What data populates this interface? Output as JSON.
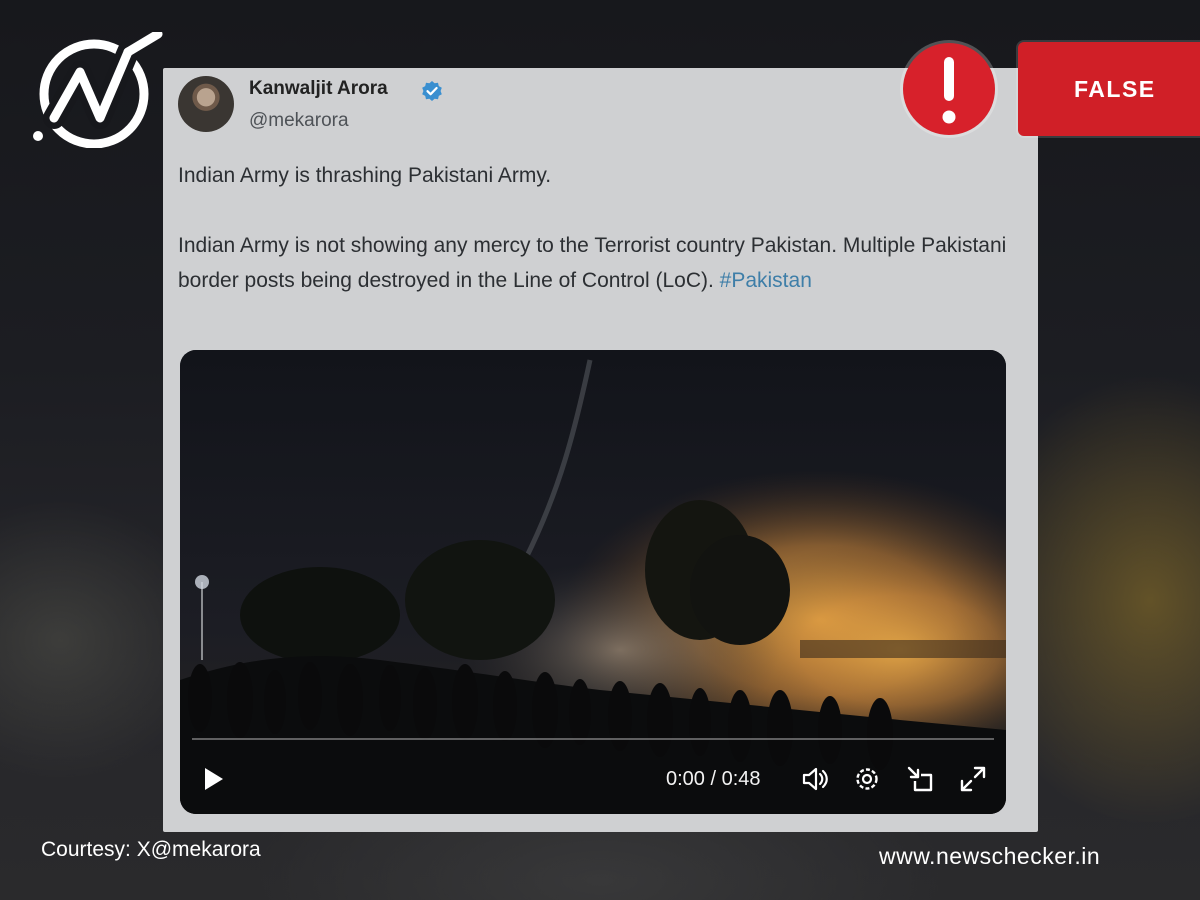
{
  "brand": {
    "logo_icon": "newschecker-logo-icon",
    "website": "www.newschecker.in"
  },
  "verdict": {
    "icon": "exclamation-alert-icon",
    "label": "FALSE",
    "color": "#d01f27"
  },
  "tweet": {
    "author_name": "Kanwaljit Arora",
    "author_handle": "@mekarora",
    "verified_icon": "verified-badge-icon",
    "text_line1": "Indian Army is thrashing Pakistani Army.",
    "text_line2": "Indian Army is not showing any mercy to the Terrorist country Pakistan. Multiple Pakistani border posts being destroyed in the Line of Control (LoC).",
    "hashtag": "#Pakistan",
    "hashtag_color": "#3e7ea8",
    "video": {
      "time": "0:00 / 0:48",
      "progress": 0,
      "icons": [
        "play-icon",
        "volume-icon",
        "settings-icon",
        "pip-icon",
        "fullscreen-icon"
      ]
    }
  },
  "footer": {
    "courtesy": "Courtesy: X@mekarora"
  }
}
